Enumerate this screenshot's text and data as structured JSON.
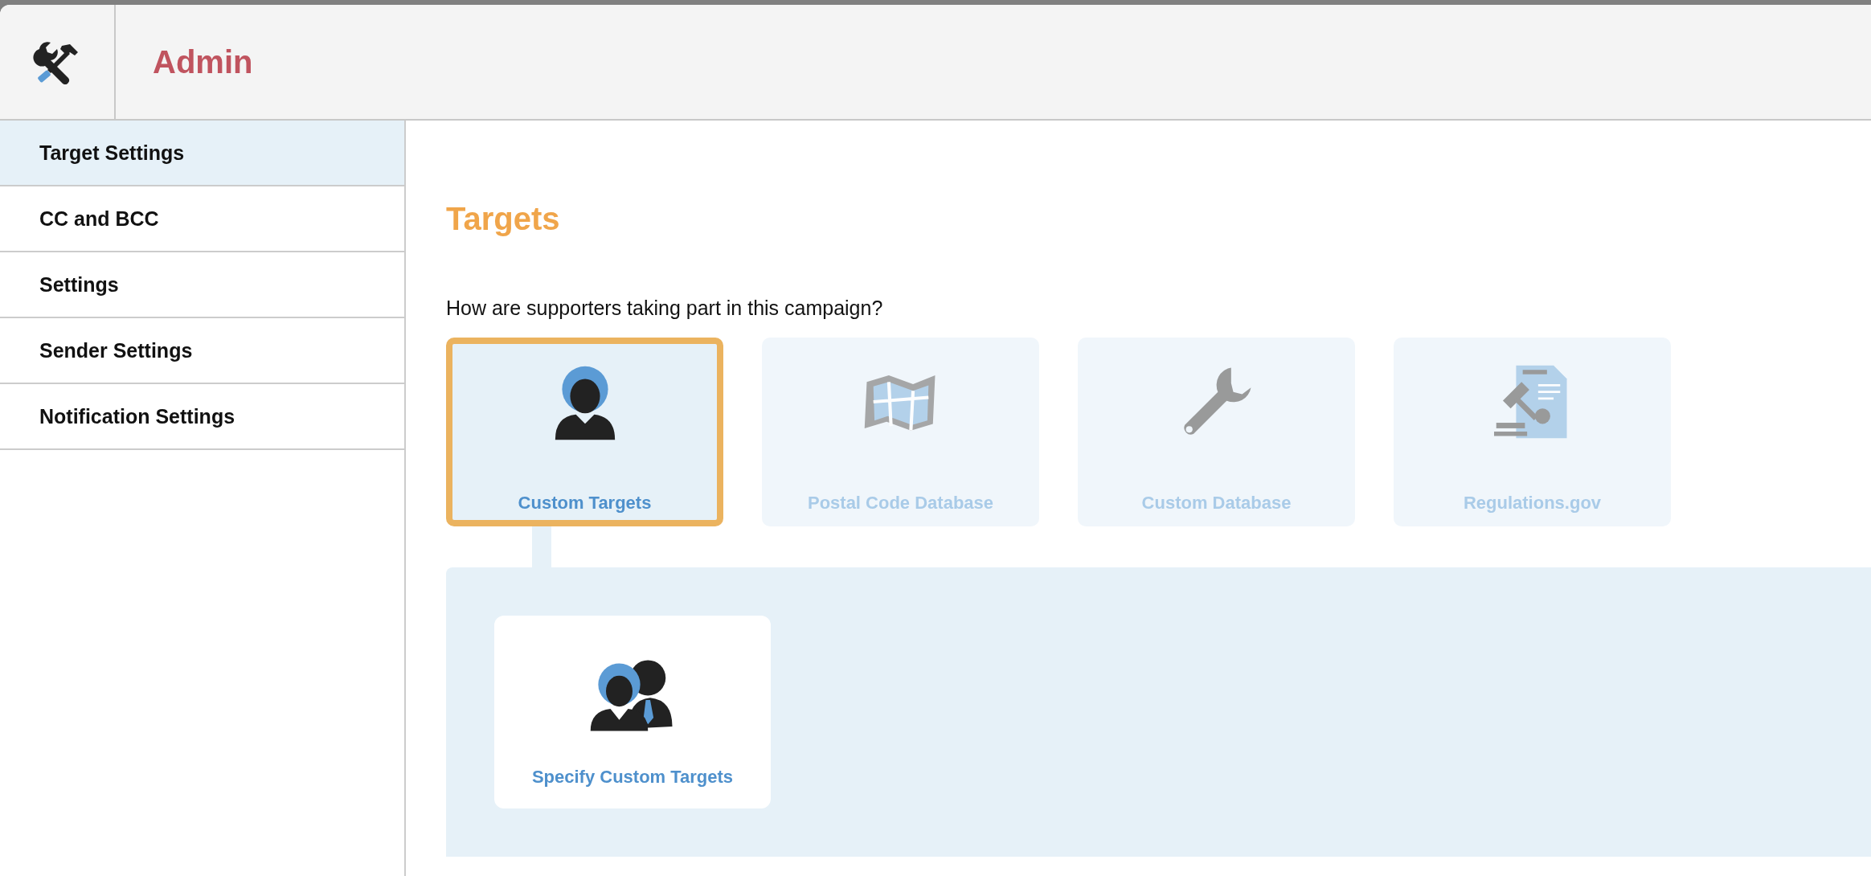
{
  "header": {
    "title": "Admin"
  },
  "sidebar": {
    "items": [
      {
        "label": "Target Settings",
        "selected": true
      },
      {
        "label": "CC and BCC",
        "selected": false
      },
      {
        "label": "Settings",
        "selected": false
      },
      {
        "label": "Sender Settings",
        "selected": false
      },
      {
        "label": "Notification Settings",
        "selected": false
      }
    ]
  },
  "main": {
    "heading": "Targets",
    "question": "How are supporters taking part in this campaign?",
    "options": [
      {
        "label": "Custom Targets",
        "selected": true
      },
      {
        "label": "Postal Code Database",
        "selected": false
      },
      {
        "label": "Custom Database",
        "selected": false
      },
      {
        "label": "Regulations.gov",
        "selected": false
      }
    ],
    "sub_options": [
      {
        "label": "Specify Custom Targets"
      }
    ]
  }
}
